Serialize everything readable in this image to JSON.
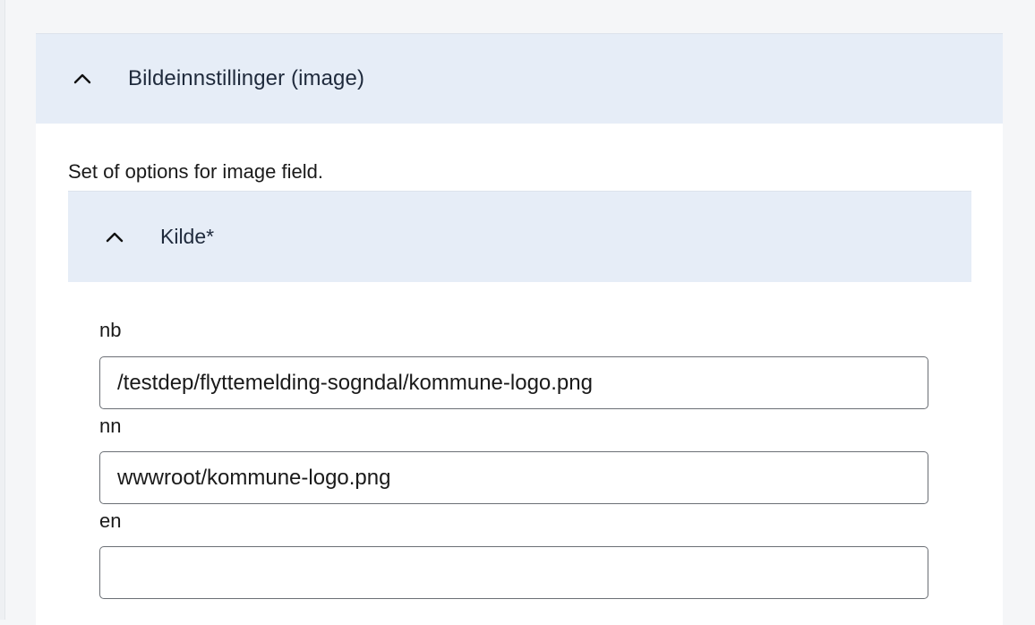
{
  "panel": {
    "title": "Bildeinnstillinger (image)",
    "description": "Set of options for image field.",
    "chevron_icon": "chevron-up-icon"
  },
  "source": {
    "title": "Kilde*",
    "chevron_icon": "chevron-up-icon",
    "fields": [
      {
        "label": "nb",
        "value": "/testdep/flyttemelding-sogndal/kommune-logo.png",
        "placeholder": ""
      },
      {
        "label": "nn",
        "value": "wwwroot/kommune-logo.png",
        "placeholder": ""
      },
      {
        "label": "en",
        "value": "",
        "placeholder": ""
      }
    ]
  },
  "colors": {
    "header_bg": "#e6edf7",
    "page_bg": "#f5f6f8",
    "text": "#1a1a1a"
  }
}
